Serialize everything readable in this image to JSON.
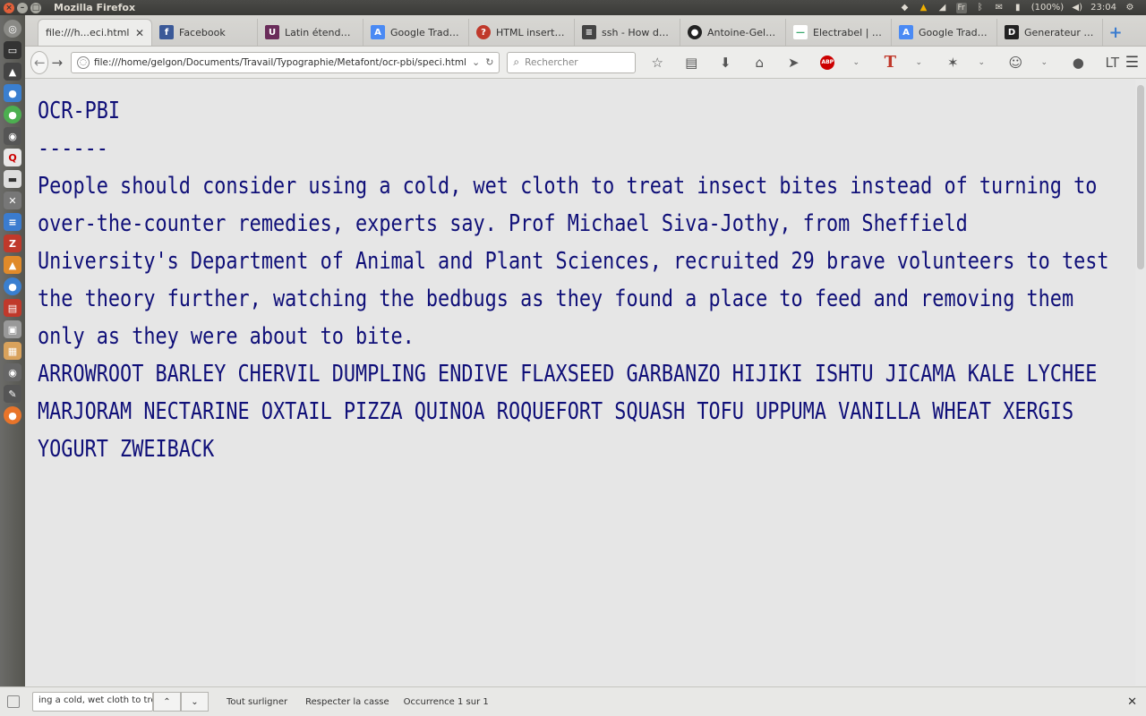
{
  "window": {
    "title": "Mozilla Firefox"
  },
  "tray": {
    "lang": "Fr",
    "battery": "(100%)",
    "time": "23:04"
  },
  "tabs": [
    {
      "label": "file:///h...eci.html",
      "icon": "file-icon",
      "active": true
    },
    {
      "label": "Facebook",
      "icon": "facebook-icon"
    },
    {
      "label": "Latin étendu B ...",
      "icon": "unicode-icon"
    },
    {
      "label": "Google Traduct...",
      "icon": "google-translate-icon"
    },
    {
      "label": "HTML insertion ...",
      "icon": "quora-icon"
    },
    {
      "label": "ssh - How do I t...",
      "icon": "stackexchange-icon"
    },
    {
      "label": "Antoine-Gelgo...",
      "icon": "github-icon"
    },
    {
      "label": "Electrabel | For...",
      "icon": "electrabel-icon"
    },
    {
      "label": "Google Traduct...",
      "icon": "google-translate-icon"
    },
    {
      "label": "Generateur de ...",
      "icon": "dafont-icon"
    }
  ],
  "nav": {
    "url": "file:///home/gelgon/Documents/Travail/Typographie/Metafont/ocr-pbi/speci.html",
    "search_placeholder": "Rechercher"
  },
  "page": {
    "title": "OCR-PBI",
    "rule": "------",
    "paragraph": "People should consider using a cold, wet cloth to treat insect bites instead of turning to over-the-counter remedies, experts say. Prof Michael Siva-Jothy, from Sheffield University's Department of Animal and Plant Sciences, recruited 29 brave volunteers to test the theory further, watching the bedbugs as they found a place to feed and removing them only as they were about to bite.",
    "caps": "ARROWROOT BARLEY CHERVIL DUMPLING ENDIVE FLAXSEED GARBANZO HIJIKI ISHTU JICAMA KALE LYCHEE MARJORAM NECTARINE OXTAIL PIZZA QUINOA ROQUEFORT SQUASH TOFU UPPUMA VANILLA WHEAT XERGIS YOGURT ZWEIBACK"
  },
  "findbar": {
    "query": "ing a cold, wet cloth to treat",
    "highlight_all": "Tout surligner",
    "match_case": "Respecter la casse",
    "status": "Occurrence 1 sur 1"
  }
}
